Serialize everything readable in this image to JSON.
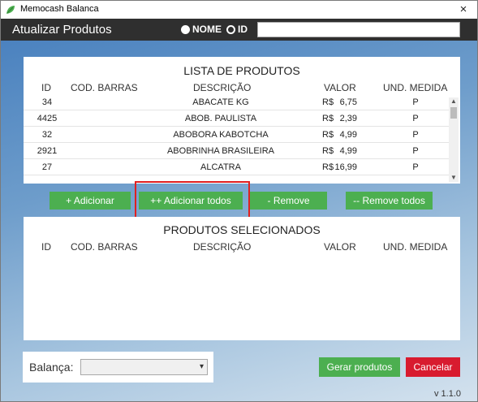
{
  "window": {
    "title": "Memocash Balanca",
    "close_icon": "×"
  },
  "header": {
    "title": "Atualizar Produtos",
    "radio_nome": "NOME",
    "radio_id": "ID",
    "search_value": ""
  },
  "produtos": {
    "title": "LISTA DE PRODUTOS",
    "columns": [
      "ID",
      "COD. BARRAS",
      "DESCRIÇÃO",
      "VALOR",
      "UND. MEDIDA"
    ],
    "currency": "R$",
    "rows": [
      {
        "id": "34",
        "barras": "",
        "desc": "ABACATE  KG",
        "valor": "6,75",
        "und": "P"
      },
      {
        "id": "4425",
        "barras": "",
        "desc": "ABOB. PAULISTA",
        "valor": "2,39",
        "und": "P"
      },
      {
        "id": "32",
        "barras": "",
        "desc": "ABOBORA KABOTCHA",
        "valor": "4,99",
        "und": "P"
      },
      {
        "id": "2921",
        "barras": "",
        "desc": "ABOBRINHA BRASILEIRA",
        "valor": "4,99",
        "und": "P"
      },
      {
        "id": "27",
        "barras": "",
        "desc": "ALCATRA",
        "valor": "16,99",
        "und": "P"
      }
    ]
  },
  "actions": {
    "adicionar": "+ Adicionar",
    "adicionar_todos": "++ Adicionar todos",
    "remove": "- Remove",
    "remove_todos": "-- Remove todos"
  },
  "selecionados": {
    "title": "PRODUTOS SELECIONADOS",
    "columns": [
      "ID",
      "COD. BARRAS",
      "DESCRIÇÃO",
      "VALOR",
      "UND. MEDIDA"
    ],
    "rows": []
  },
  "footer": {
    "balanca_label": "Balança:",
    "balanca_value": "",
    "gerar": "Gerar produtos",
    "cancelar": "Cancelar",
    "version": "v 1.1.0"
  },
  "colors": {
    "header_bg": "#2f2f2f",
    "button_green": "#4caf50",
    "button_red": "#d81b2f",
    "highlight_red": "#e02020"
  },
  "icons": {
    "app": "memocash-leaf-icon",
    "scroll_up": "▲",
    "scroll_down": "▼",
    "select_chevron": "▾"
  }
}
